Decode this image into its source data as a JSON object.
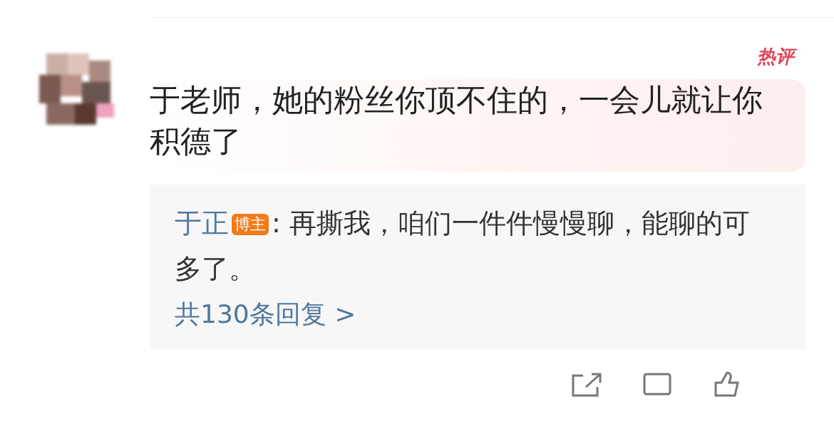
{
  "comment": {
    "hot_badge": "热评",
    "text": "于老师，她的粉丝你顶不住的，一会儿就让你积德了"
  },
  "reply": {
    "author": "于正",
    "author_badge": "博主",
    "text": ": 再撕我，咱们一件件慢慢聊，能聊的可多了。",
    "more": "共130条回复 >"
  }
}
